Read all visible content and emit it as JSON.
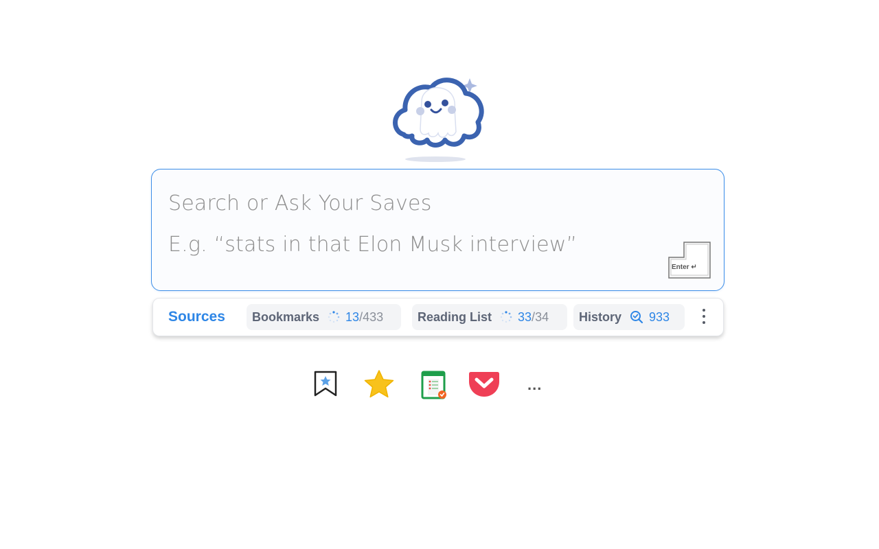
{
  "search": {
    "placeholder_title": "Search or Ask Your Saves",
    "placeholder_example": "E.g. “stats in that Elon Musk interview”",
    "enter_key_label": "Enter ↵"
  },
  "sources": {
    "label": "Sources",
    "items": [
      {
        "name": "Bookmarks",
        "current": "13",
        "separator": "/",
        "total": "433",
        "status_icon": "loading-spinner-icon"
      },
      {
        "name": "Reading List",
        "current": "33",
        "separator": "/",
        "total": "34",
        "status_icon": "loading-spinner-icon"
      },
      {
        "name": "History",
        "current": "933",
        "status_icon": "search-check-icon"
      }
    ]
  },
  "import_sources": {
    "icons": [
      "bookmark-star-icon",
      "star-icon",
      "notes-checklist-icon",
      "pocket-icon"
    ],
    "more_label": "..."
  },
  "colors": {
    "accent": "#2e86e6",
    "search_border": "#3d8ee8",
    "pocket_red": "#ef3f56",
    "star_yellow": "#f8c21c"
  }
}
